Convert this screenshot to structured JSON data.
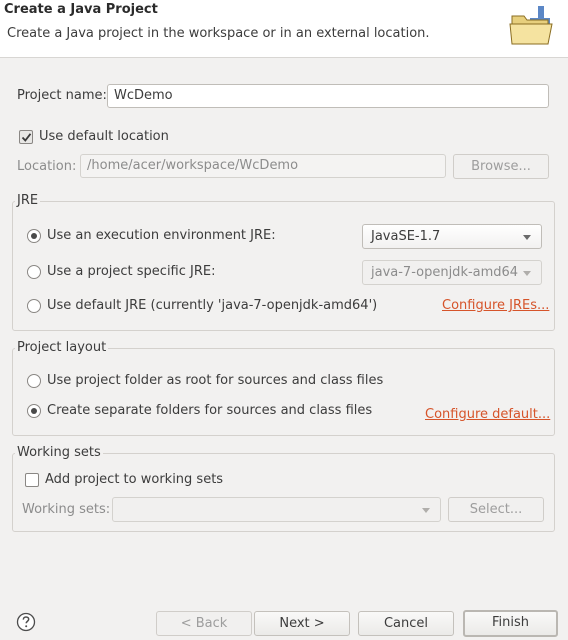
{
  "banner": {
    "title": "Create a Java Project",
    "description": "Create a Java project in the workspace or in an external location."
  },
  "project_name": {
    "label": "Project name:",
    "value": "WcDemo"
  },
  "location": {
    "use_default_label": "Use default location",
    "use_default_checked": true,
    "label": "Location:",
    "value": "/home/acer/workspace/WcDemo",
    "browse_label": "Browse..."
  },
  "jre": {
    "group_title": "JRE",
    "options": [
      {
        "label": "Use an execution environment JRE:",
        "checked": true
      },
      {
        "label": "Use a project specific JRE:",
        "checked": false
      },
      {
        "label": "Use default JRE (currently 'java-7-openjdk-amd64')",
        "checked": false
      }
    ],
    "execution_env_value": "JavaSE-1.7",
    "project_specific_value": "java-7-openjdk-amd64",
    "configure_link": "Configure JREs..."
  },
  "layout": {
    "group_title": "Project layout",
    "options": [
      {
        "label": "Use project folder as root for sources and class files",
        "checked": false
      },
      {
        "label": "Create separate folders for sources and class files",
        "checked": true
      }
    ],
    "configure_link": "Configure default..."
  },
  "working_sets": {
    "group_title": "Working sets",
    "add_label": "Add project to working sets",
    "add_checked": false,
    "label": "Working sets:",
    "value": "",
    "select_label": "Select..."
  },
  "footer": {
    "help_icon": "help-icon",
    "back_label": "< Back",
    "next_label": "Next >",
    "cancel_label": "Cancel",
    "finish_label": "Finish"
  },
  "colors": {
    "link": "#d6542a",
    "background": "#f2f1f0"
  }
}
